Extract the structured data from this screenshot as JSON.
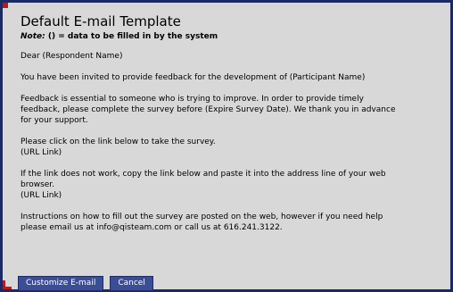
{
  "title": "Default E-mail Template",
  "note": {
    "label": "Note:",
    "text": "() = data to be filled in by the system"
  },
  "greeting": "Dear (Respondent Name)",
  "invite": "You have been invited to provide feedback for the development of (Participant Name)",
  "feedback": [
    "Feedback is essential to someone who is trying to improve. In order to provide timely",
    "feedback, please complete the survey before (Expire Survey Date). We thank you in advance",
    "for your support."
  ],
  "link_intro": [
    "Please click on the link below to take the survey.",
    "(URL Link)"
  ],
  "link_fallback": [
    "If the link does not work, copy the link below and paste it into the address line of your web",
    "browser.",
    "(URL Link)"
  ],
  "instructions": [
    "Instructions on how to fill out the survey are posted on the web, however if you need help",
    "please email us at info@qisteam.com or call us at 616.241.3122."
  ],
  "buttons": {
    "customize": "Customize E-mail",
    "cancel": "Cancel"
  }
}
